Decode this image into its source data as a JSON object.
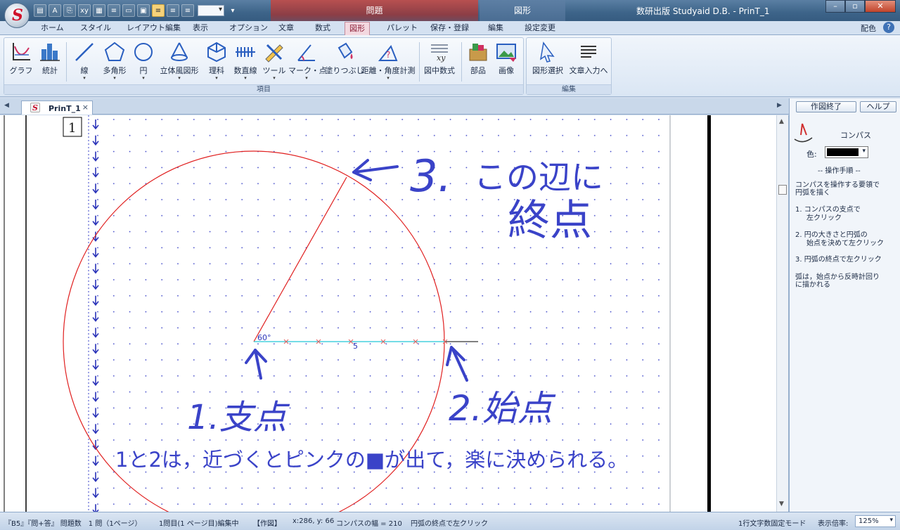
{
  "titlebar": {
    "app_logo_letter": "S",
    "context_tab_mondai": "問題",
    "context_tab_zukei": "図形",
    "title": "数研出版 Studyaid D.B. - PrinT_1",
    "min_icon": "minimize-icon",
    "max_icon": "maximize-icon",
    "close_icon": "close-icon"
  },
  "ribbon_tabs": [
    "ホーム",
    "スタイル",
    "レイアウト編集",
    "表示",
    "オプション",
    "文章",
    "数式",
    "図形",
    "パレット",
    "保存・登録",
    "編集",
    "設定変更"
  ],
  "active_tab": "図形",
  "ribbon_right": {
    "haishoku": "配色",
    "help": "?"
  },
  "ribbon": {
    "group_items_label": "項目",
    "group_edit_label": "編集",
    "buttons": {
      "graph": "グラフ",
      "stats": "統計",
      "line": "線",
      "polygon": "多角形",
      "circle": "円",
      "solid": "立体風図形",
      "science": "理科",
      "numberline": "数直線",
      "tool": "ツール",
      "mark": "マーク・点",
      "fill": "塗りつぶし",
      "distance": "距離・角度計測",
      "formula": "図中数式",
      "parts": "部品",
      "image": "画像",
      "select": "図形選択",
      "textinput": "文章入力へ"
    }
  },
  "doc_tab": {
    "icon_letter": "S",
    "name": "PrinT_1",
    "close": "×"
  },
  "canvas": {
    "problem_number": "1",
    "angle_label": "60°",
    "length_label": "5",
    "annot_3_num": "3.",
    "annot_3_line1": "この辺に",
    "annot_3_line2": "終点",
    "annot_1": "1.支点",
    "annot_2": "2.始点",
    "bottom_note": "1と2は，近づくとピンクの■が出て，楽に決められる。"
  },
  "right_pane": {
    "finish_button": "作図終了",
    "help_button": "ヘルプ",
    "tool_name": "コンパス",
    "color_label": "色:",
    "color_value": "#000000",
    "steps_header": "-- 操作手順 --",
    "steps_intro_1": "コンパスを操作する要領で",
    "steps_intro_2": "円弧を描く",
    "step1_a": "1. コンパスの支点で",
    "step1_b": "左クリック",
    "step2_a": "2. 円の大きさと円弧の",
    "step2_b": "始点を決めて左クリック",
    "step3": "3. 円弧の終点で左クリック",
    "note_1": "弧は，始点から反時計回り",
    "note_2": "に描かれる"
  },
  "status": {
    "paper": "『B5』『問+答』 問題数　1 問（1ページ）",
    "editing": "1問目(1 ページ目)編集中",
    "mode": "【作図】",
    "coords": "x:286, y: 66",
    "compass_width": "コンパスの幅 = 210",
    "hint": "円弧の終点で左クリック",
    "fixed_mode": "1行文字数固定モード",
    "zoom_label": "表示倍率:",
    "zoom_value": "125%"
  },
  "colors": {
    "ink": "#3a43c8",
    "circle": "#e02020",
    "cyan_line": "#20c8d8",
    "dot_grid": "#3a43c8"
  }
}
